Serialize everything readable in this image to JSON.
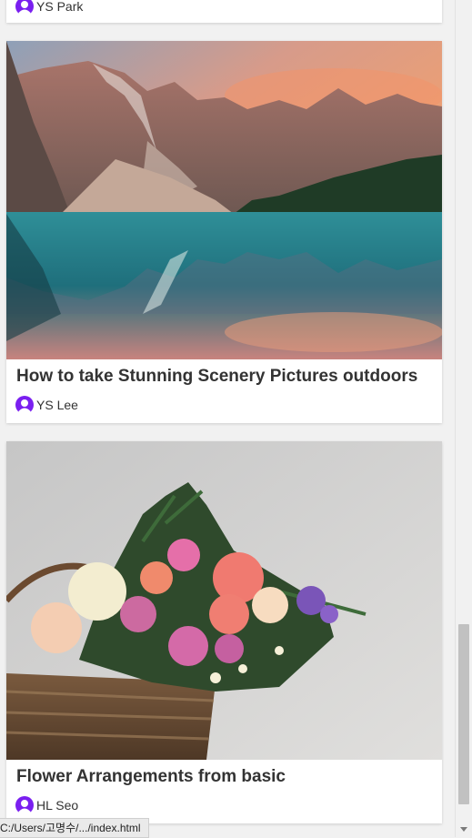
{
  "feed": {
    "posts": [
      {
        "title": "",
        "author": "YS Park"
      },
      {
        "title": "How to take Stunning Scenery Pictures outdoors",
        "author": "YS Lee"
      },
      {
        "title": "Flower Arrangements from basic",
        "author": "HL Seo"
      }
    ]
  },
  "status_bar": {
    "url": "C:/Users/고명수/.../index.html"
  },
  "colors": {
    "avatar": "#7a1ff0",
    "card_bg": "#ffffff",
    "page_bg": "#f1f1f1"
  },
  "icons": {
    "avatar": "user-avatar-icon"
  }
}
